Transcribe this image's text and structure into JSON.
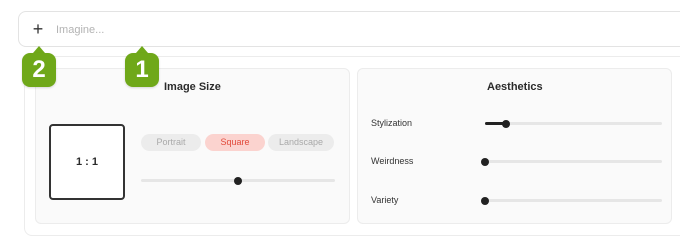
{
  "prompt": {
    "placeholder": "Imagine...",
    "add_icon": "plus-icon"
  },
  "image_size": {
    "title": "Image Size",
    "ratio": "1 : 1",
    "orientations": [
      "Portrait",
      "Square",
      "Landscape"
    ],
    "selected": "Square",
    "size_level": 0.5
  },
  "aesthetics": {
    "title": "Aesthetics",
    "stylization": {
      "label": "Stylization",
      "level": 0.12
    },
    "weirdness": {
      "label": "Weirdness",
      "level": 0.0
    },
    "variety": {
      "label": "Variety",
      "level": 0.0
    }
  },
  "annotations": {
    "badge_1": "1",
    "badge_2": "2"
  },
  "colors": {
    "accent": "#e24a3b",
    "accent_bg": "#fbd3cf",
    "badge": "#6fa819"
  }
}
